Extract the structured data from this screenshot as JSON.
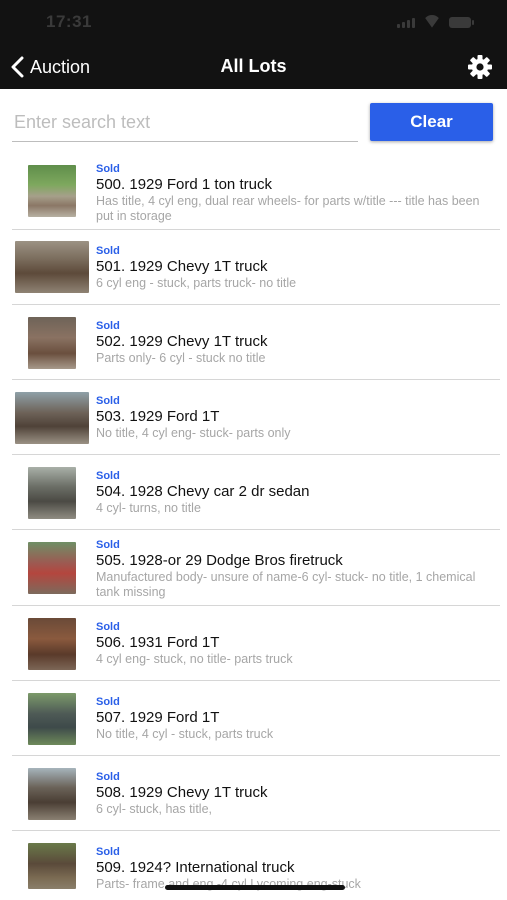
{
  "status_bar": {
    "time": "17:31"
  },
  "nav": {
    "back_label": "Auction",
    "title": "All Lots"
  },
  "search": {
    "placeholder": "Enter search text",
    "value": "",
    "clear_label": "Clear"
  },
  "accent_color": "#2a5fe8",
  "lots": [
    {
      "status": "Sold",
      "title": "500. 1929 Ford 1 ton truck",
      "description": "Has title, 4 cyl eng, dual rear wheels- for parts w/title --- title has been put in storage"
    },
    {
      "status": "Sold",
      "title": "501. 1929 Chevy 1T truck",
      "description": "6 cyl eng - stuck, parts truck- no title"
    },
    {
      "status": "Sold",
      "title": "502. 1929 Chevy 1T truck",
      "description": "Parts only- 6 cyl - stuck no title"
    },
    {
      "status": "Sold",
      "title": "503. 1929 Ford 1T",
      "description": "No title, 4 cyl eng- stuck- parts only"
    },
    {
      "status": "Sold",
      "title": "504. 1928 Chevy car 2 dr sedan",
      "description": "4 cyl- turns, no title"
    },
    {
      "status": "Sold",
      "title": "505. 1928-or 29 Dodge Bros firetruck",
      "description": "Manufactured body- unsure of name-6 cyl- stuck- no title, 1 chemical tank missing"
    },
    {
      "status": "Sold",
      "title": "506. 1931 Ford 1T",
      "description": "4 cyl eng- stuck, no title- parts truck"
    },
    {
      "status": "Sold",
      "title": "507. 1929 Ford 1T",
      "description": "No title, 4 cyl - stuck, parts truck"
    },
    {
      "status": "Sold",
      "title": "508. 1929 Chevy 1T truck",
      "description": "6 cyl- stuck, has title,"
    },
    {
      "status": "Sold",
      "title": "509. 1924? International truck",
      "description": "Parts- frame and eng -4 cyl Lycoming eng-stuck"
    }
  ]
}
